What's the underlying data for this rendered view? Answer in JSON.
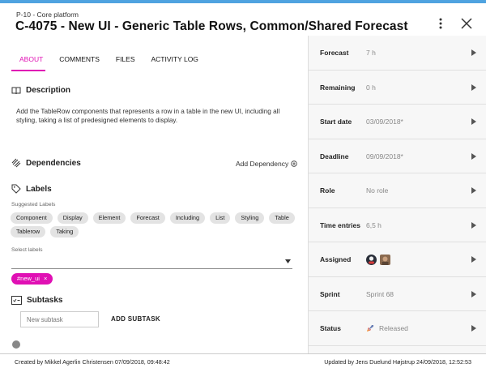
{
  "header": {
    "breadcrumb": "P-10 - Core platform",
    "title": "C-4075 -  New UI - Generic Table Rows, Common/Shared Forecast"
  },
  "tabs": [
    {
      "label": "ABOUT",
      "active": true
    },
    {
      "label": "COMMENTS",
      "active": false
    },
    {
      "label": "FILES",
      "active": false
    },
    {
      "label": "ACTIVITY LOG",
      "active": false
    }
  ],
  "description": {
    "heading": "Description",
    "text": "Add the TableRow components that represents a row in a table in the new UI, including all styling, taking a list of predesigned elements to display."
  },
  "dependencies": {
    "heading": "Dependencies",
    "add_label": "Add Dependency"
  },
  "labels": {
    "heading": "Labels",
    "suggested_label": "Suggested Labels",
    "suggested": [
      "Component",
      "Display",
      "Element",
      "Forecast",
      "Including",
      "List",
      "Styling",
      "Table",
      "Tablerow",
      "Taking"
    ],
    "select_label": "Select labels",
    "selected": [
      "#new_ui"
    ],
    "remove_glyph": "×"
  },
  "subtasks": {
    "heading": "Subtasks",
    "input_placeholder": "New subtask",
    "add_button": "ADD SUBTASK"
  },
  "sidebar": {
    "rows": [
      {
        "label": "Forecast",
        "value": "7 h"
      },
      {
        "label": "Remaining",
        "value": "0 h"
      },
      {
        "label": "Start date",
        "value": "03/09/2018*"
      },
      {
        "label": "Deadline",
        "value": "09/09/2018*"
      },
      {
        "label": "Role",
        "value": "No role"
      },
      {
        "label": "Time entries",
        "value": "6,5 h"
      },
      {
        "label": "Assigned",
        "value": ""
      },
      {
        "label": "Sprint",
        "value": "Sprint 68"
      },
      {
        "label": "Status",
        "value": "Released"
      }
    ]
  },
  "footer": {
    "created": "Created by Mikkel Agerlin Christensen 07/09/2018, 09:48:42",
    "updated": "Updated by Jens Duelund Højstrup 24/09/2018, 12:52:53"
  },
  "colors": {
    "accent": "#e010b4",
    "topbar": "#4fa3e0"
  }
}
